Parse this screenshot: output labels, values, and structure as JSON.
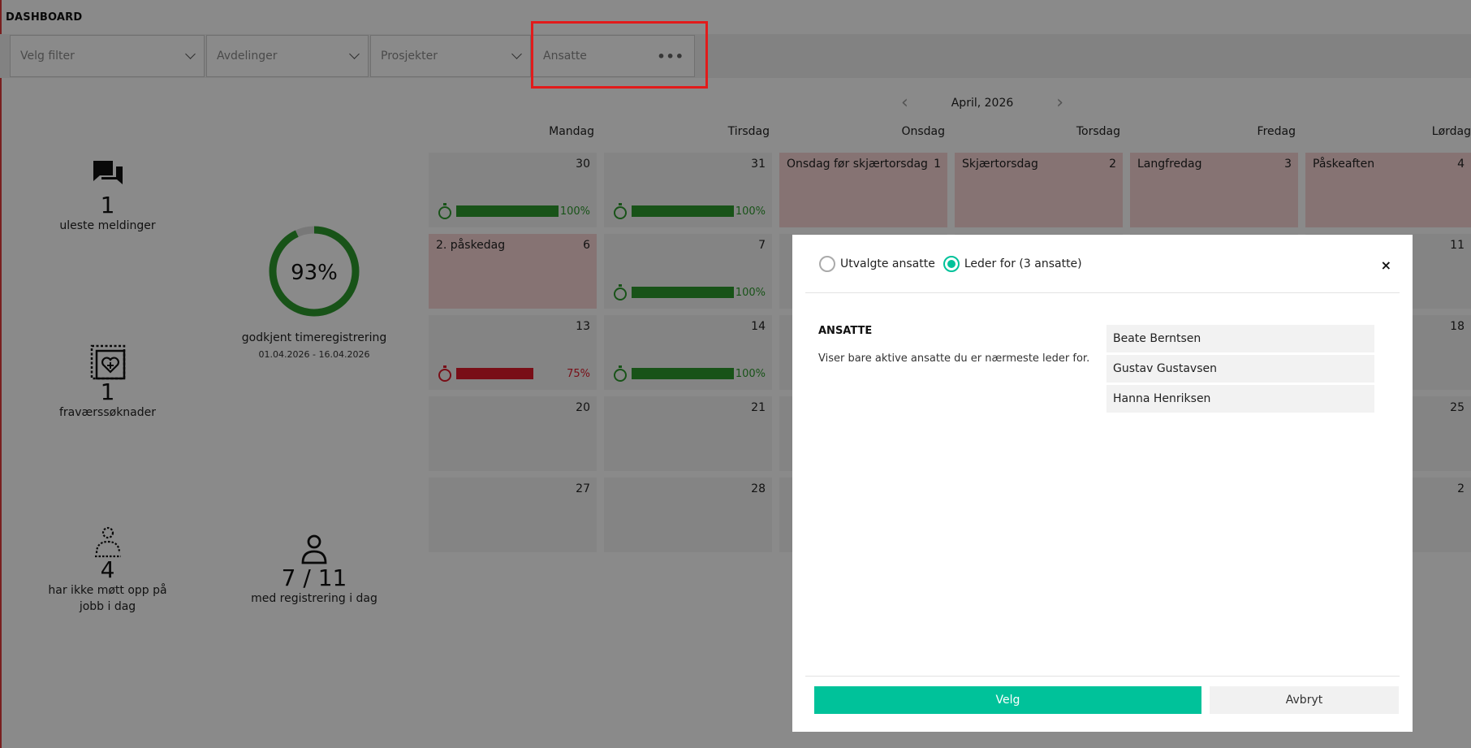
{
  "header": {
    "title": "DASHBOARD"
  },
  "filters": {
    "velg_filter": "Velg filter",
    "avdelinger": "Avdelinger",
    "prosjekter": "Prosjekter",
    "ansatte": "Ansatte",
    "more": "•••"
  },
  "tiles": {
    "messages": {
      "count": "1",
      "label": "uleste meldinger"
    },
    "approval": {
      "percent": "93%",
      "percent_value": 93,
      "label": "godkjent timeregistrering",
      "period": "01.04.2026 - 16.04.2026"
    },
    "absence": {
      "count": "1",
      "label": "fraværssøknader"
    },
    "absent": {
      "count": "4",
      "label": "har ikke møtt opp på jobb i dag"
    },
    "registered": {
      "count": "7 / 11",
      "label": "med registrering i dag"
    }
  },
  "calendar": {
    "month": "April, 2026",
    "prev": "‹",
    "next": "›",
    "days": [
      "Mandag",
      "Tirsdag",
      "Onsdag",
      "Torsdag",
      "Fredag",
      "Lørdag"
    ],
    "row1": {
      "mon": {
        "num": "30",
        "pct": "100%",
        "value": 100
      },
      "tue": {
        "num": "31",
        "pct": "100%",
        "value": 100
      },
      "wed": {
        "num": "1",
        "name": "Onsdag før skjærtorsdag"
      },
      "thu": {
        "num": "2",
        "name": "Skjærtorsdag"
      },
      "fri": {
        "num": "3",
        "name": "Langfredag"
      },
      "sat": {
        "num": "4",
        "name": "Påskeaften"
      }
    },
    "row2": {
      "mon": {
        "num": "6",
        "name": "2. påskedag"
      },
      "tue": {
        "num": "7",
        "pct": "100%",
        "value": 100
      },
      "sat": {
        "num": "11"
      }
    },
    "row3": {
      "mon": {
        "num": "13",
        "pct": "75%",
        "value": 75
      },
      "tue": {
        "num": "14",
        "pct": "100%",
        "value": 100
      },
      "sat": {
        "num": "18"
      }
    },
    "row4": {
      "mon": {
        "num": "20"
      },
      "tue": {
        "num": "21"
      },
      "sat": {
        "num": "25"
      }
    },
    "row5": {
      "mon": {
        "num": "27"
      },
      "tue": {
        "num": "28"
      },
      "sat": {
        "num": "2"
      }
    }
  },
  "modal": {
    "radio_selected": "Utvalgte ansatte",
    "radio_leader": "Leder for (3 ansatte)",
    "close": "×",
    "section_title": "ANSATTE",
    "section_desc": "Viser bare aktive ansatte du er nærmeste leder for.",
    "employees": [
      "Beate Berntsen",
      "Gustav Gustavsen",
      "Hanna Henriksen"
    ],
    "ok_label": "Velg",
    "cancel_label": "Avbryt"
  },
  "colors": {
    "accent": "#00c29a",
    "success": "#2e9a2e",
    "danger": "#e01b2b",
    "holiday": "#f7d4d4",
    "highlight": "#e21b1b"
  }
}
